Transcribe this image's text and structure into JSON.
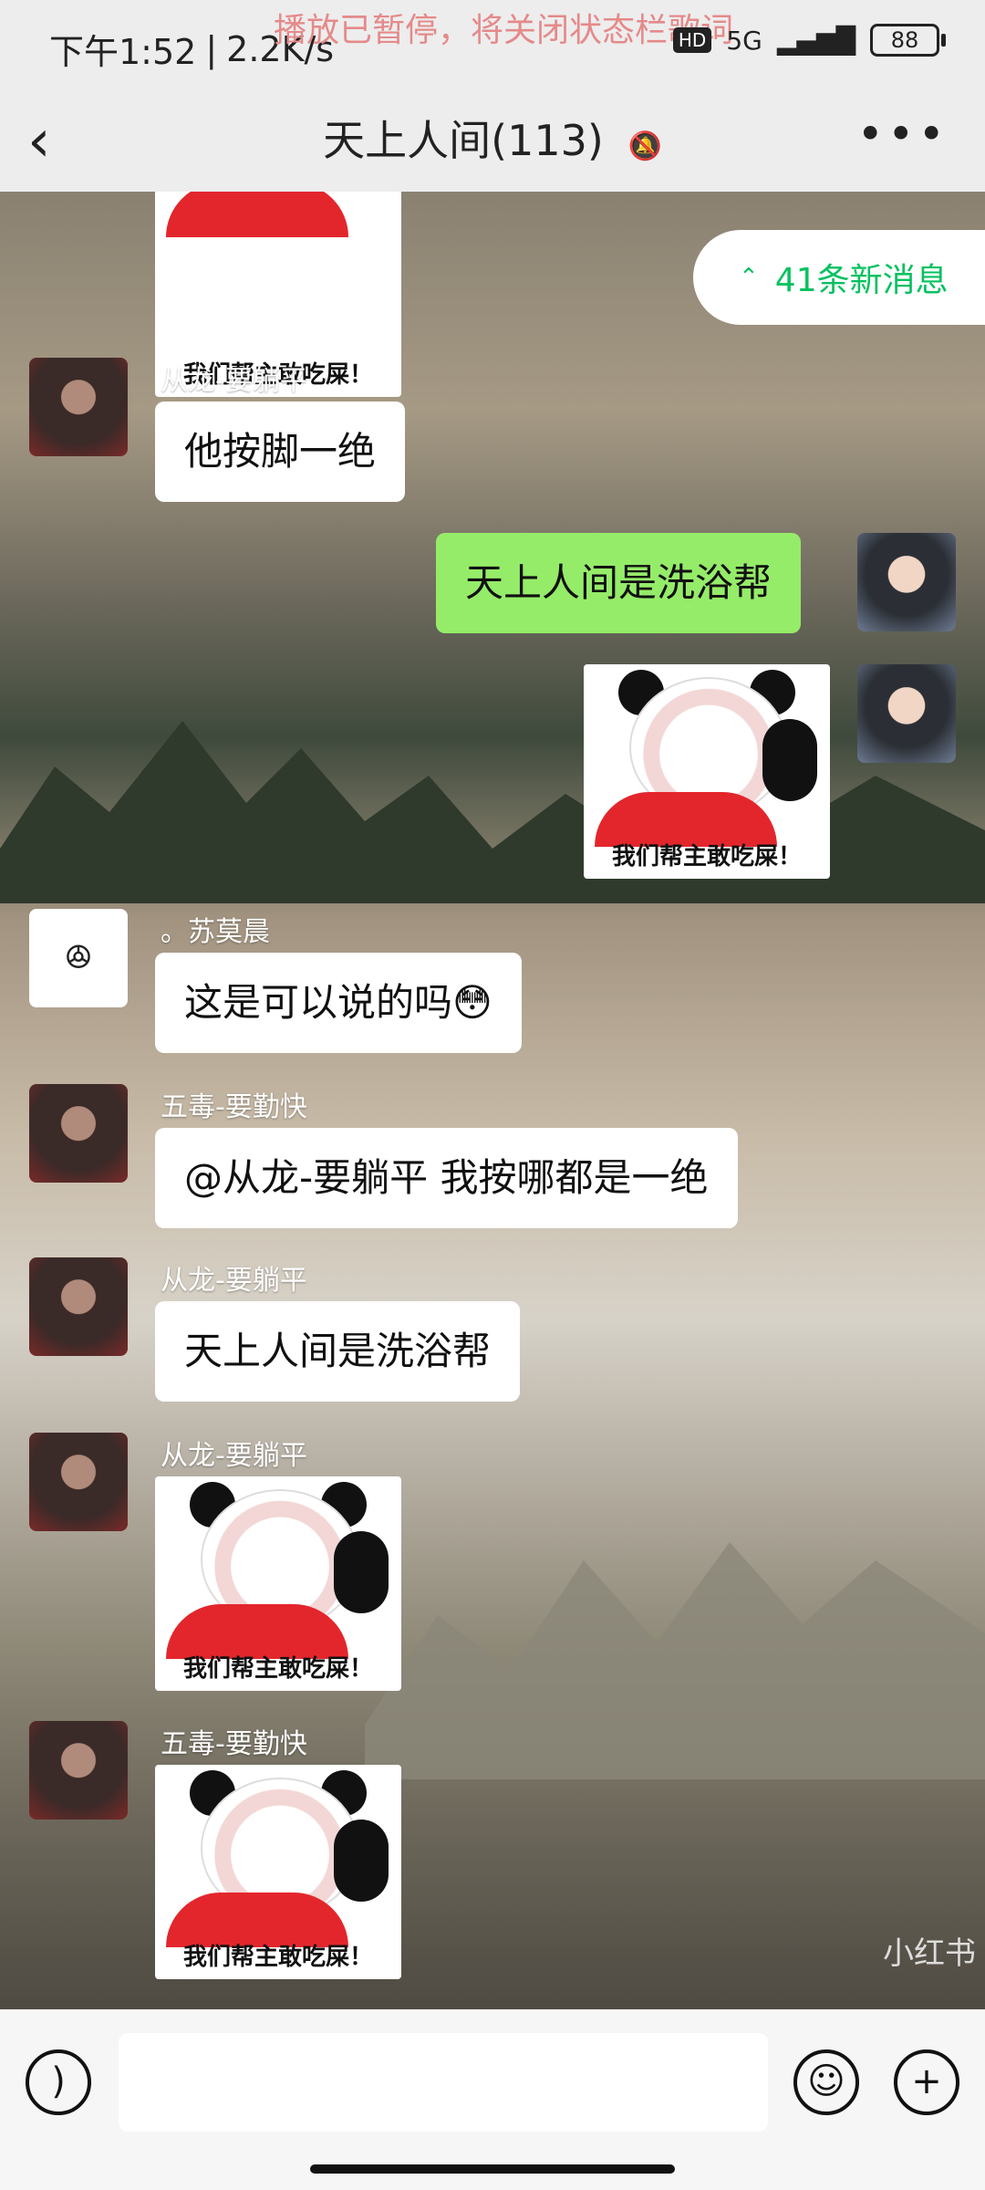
{
  "status": {
    "time": "下午1:52",
    "speed": "2.2K/s",
    "lyric_notice": "播放已暂停，将关闭状态栏歌词",
    "hd": "HD",
    "network": "5G",
    "battery": "88"
  },
  "header": {
    "title": "天上人间(113)",
    "back_icon": "chevron-left-icon",
    "mute_icon": "bell-off-icon",
    "more_icon": "more-dots-icon"
  },
  "new_messages": "41条新消息",
  "sticker_caption": "我们帮主敢吃屎！",
  "messages": [
    {
      "sender": "从龙-要躺平",
      "text": "他按脚一绝"
    },
    {
      "sender": "",
      "text": "天上人间是洗浴帮"
    },
    {
      "sender": "。苏莫晨",
      "text": "这是可以说的吗😳"
    },
    {
      "sender": "五毒-要勤快",
      "text": "@从龙-要躺平  我按哪都是一绝"
    },
    {
      "sender": "从龙-要躺平",
      "text": "天上人间是洗浴帮"
    },
    {
      "sender": "从龙-要躺平",
      "text": ""
    },
    {
      "sender": "五毒-要勤快",
      "text": ""
    }
  ],
  "watermark": "小红书",
  "input_bar": {
    "voice_icon": "voice-icon",
    "emoji_icon": "emoji-icon",
    "plus_icon": "plus-icon"
  }
}
